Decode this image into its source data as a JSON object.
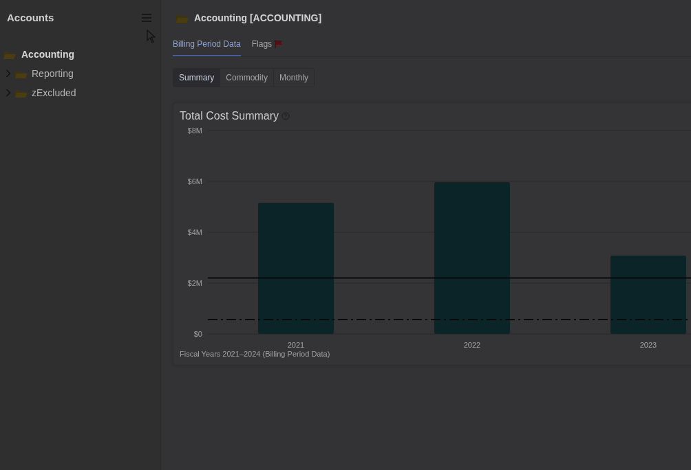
{
  "sidebar": {
    "title": "Accounts",
    "tree": [
      {
        "label": "Accounting",
        "selected": true,
        "children": [
          {
            "label": "Reporting",
            "selected": false,
            "expanded": false
          },
          {
            "label": "zExcluded",
            "selected": false,
            "expanded": false
          }
        ]
      }
    ]
  },
  "header": {
    "title": "Accounting [ACCOUNTING]"
  },
  "tabs": [
    {
      "label": "Billing Period Data",
      "selected": true,
      "flagged": false
    },
    {
      "label": "Flags",
      "selected": false,
      "flagged": true
    }
  ],
  "views": [
    {
      "label": "Summary",
      "selected": true
    },
    {
      "label": "Commodity",
      "selected": false
    },
    {
      "label": "Monthly",
      "selected": false
    }
  ],
  "card": {
    "title": "Total Cost Summary",
    "caption": "Fiscal Years 2021–2024 (Billing Period Data)",
    "chart_data": {
      "type": "bar",
      "categories": [
        "2021",
        "2022",
        "2023"
      ],
      "values": [
        5.16,
        5.97,
        3.08
      ],
      "ylim": [
        0,
        8
      ],
      "grid": true,
      "yticks": [
        {
          "value": 0,
          "label": "$0"
        },
        {
          "value": 2,
          "label": "$2M"
        },
        {
          "value": 4,
          "label": "$4M"
        },
        {
          "value": 6,
          "label": "$6M"
        },
        {
          "value": 8,
          "label": "$8M"
        }
      ],
      "ref_lines": [
        {
          "axis": "y",
          "value": 2.2
        },
        {
          "axis": "y",
          "value": 0.57
        }
      ]
    }
  }
}
